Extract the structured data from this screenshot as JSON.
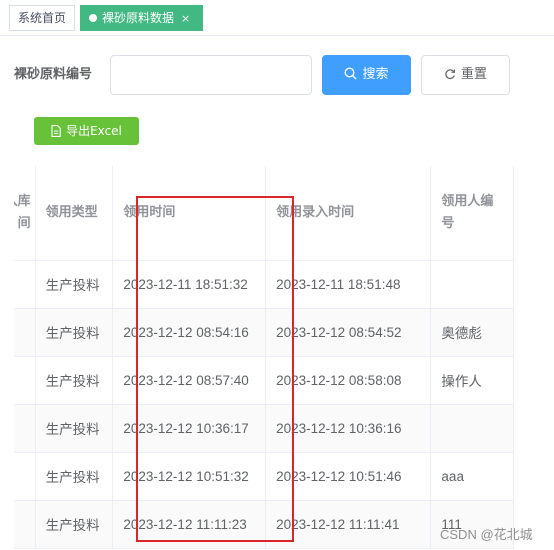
{
  "tabs": [
    {
      "label": "系统首页"
    },
    {
      "label": "裸砂原料数据",
      "close": "×"
    }
  ],
  "form": {
    "label": "裸砂原料编号",
    "input_value": "",
    "search_label": "搜索",
    "reset_label": "重置",
    "export_label": "导出Excel"
  },
  "table": {
    "headers": [
      "录入库间",
      "领用类型",
      "领用时间",
      "领用录入时间",
      "领用人编号"
    ],
    "rows": [
      {
        "type": "生产投料",
        "time": "2023-12-11 18:51:32",
        "entry_time": "2023-12-11 18:51:48",
        "user": ""
      },
      {
        "type": "生产投料",
        "time": "2023-12-12 08:54:16",
        "entry_time": "2023-12-12 08:54:52",
        "user": "奥德彪"
      },
      {
        "type": "生产投料",
        "time": "2023-12-12 08:57:40",
        "entry_time": "2023-12-12 08:58:08",
        "user": "操作人"
      },
      {
        "type": "生产投料",
        "time": "2023-12-12 10:36:17",
        "entry_time": "2023-12-12 10:36:16",
        "user": ""
      },
      {
        "type": "生产投料",
        "time": "2023-12-12 10:51:32",
        "entry_time": "2023-12-12 10:51:46",
        "user": "aaa"
      },
      {
        "type": "生产投料",
        "time": "2023-12-12 11:11:23",
        "entry_time": "2023-12-12 11:11:41",
        "user": "111"
      }
    ]
  },
  "watermark": "CSDN @花北城",
  "colors": {
    "active_tab": "#42b983",
    "primary": "#409eff",
    "success": "#67c23a",
    "highlight": "#d9262c"
  }
}
